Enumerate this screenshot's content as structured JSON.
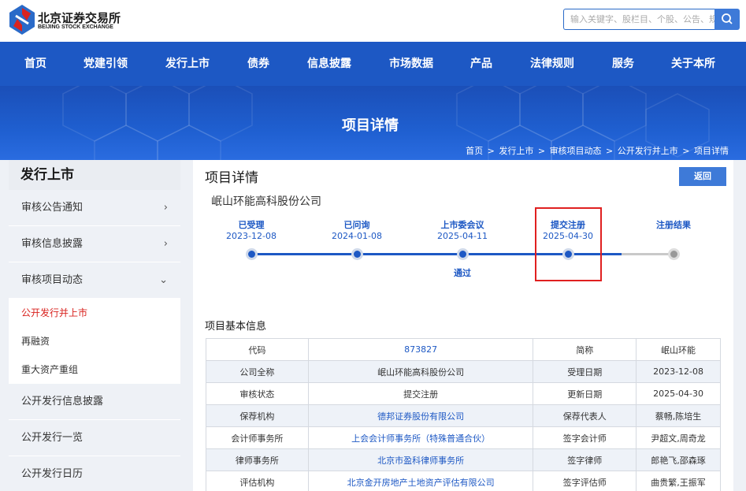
{
  "header": {
    "logo_cn": "北京证券交易所",
    "logo_en": "BEIJING STOCK EXCHANGE",
    "search_placeholder": "输入关键字、股栏目、个股、公告、规则"
  },
  "nav": [
    "首页",
    "党建引领",
    "发行上市",
    "债券",
    "信息披露",
    "市场数据",
    "产品",
    "法律规则",
    "服务",
    "关于本所"
  ],
  "banner": {
    "title": "项目详情",
    "breadcrumb": [
      "首页",
      "发行上市",
      "审核项目动态",
      "公开发行并上市",
      "项目详情"
    ]
  },
  "sidebar": {
    "title": "发行上市",
    "items": [
      {
        "label": "审核公告通知",
        "chevron": "›"
      },
      {
        "label": "审核信息披露",
        "chevron": "›"
      },
      {
        "label": "审核项目动态",
        "chevron": "⌄"
      }
    ],
    "subitems": [
      {
        "label": "公开发行并上市",
        "active": true
      },
      {
        "label": "再融资",
        "active": false
      },
      {
        "label": "重大资产重组",
        "active": false
      }
    ],
    "more": [
      "公开发行信息披露",
      "公开发行一览",
      "公开发行日历"
    ]
  },
  "main": {
    "title": "项目详情",
    "back_label": "返回",
    "company": "岷山环能高科股份公司",
    "timeline": [
      {
        "label": "已受理",
        "date": "2023-12-08",
        "note": "",
        "done": true
      },
      {
        "label": "已问询",
        "date": "2024-01-08",
        "note": "",
        "done": true
      },
      {
        "label": "上市委会议",
        "date": "2025-04-11",
        "note": "通过",
        "done": true
      },
      {
        "label": "提交注册",
        "date": "2025-04-30",
        "note": "",
        "done": true
      },
      {
        "label": "注册结果",
        "date": "",
        "note": "",
        "done": false
      }
    ],
    "basic_title": "项目基本信息",
    "rows": [
      {
        "k1": "代码",
        "v1": "873827",
        "k2": "简称",
        "v2": "岷山环能",
        "v1link": true
      },
      {
        "k1": "公司全称",
        "v1": "岷山环能高科股份公司",
        "k2": "受理日期",
        "v2": "2023-12-08",
        "v1link": false
      },
      {
        "k1": "审核状态",
        "v1": "提交注册",
        "k2": "更新日期",
        "v2": "2025-04-30",
        "v1link": false
      },
      {
        "k1": "保荐机构",
        "v1": "德邦证券股份有限公司",
        "k2": "保荐代表人",
        "v2": "蔡畅,陈培生",
        "v1link": true
      },
      {
        "k1": "会计师事务所",
        "v1": "上会会计师事务所（特殊普通合伙）",
        "k2": "签字会计师",
        "v2": "尹超文,周奇龙",
        "v1link": true
      },
      {
        "k1": "律师事务所",
        "v1": "北京市盈科律师事务所",
        "k2": "签字律师",
        "v2": "郎艳飞,邵森琢",
        "v1link": true
      },
      {
        "k1": "评估机构",
        "v1": "北京金开房地产土地资产评估有限公司",
        "k2": "签字评估师",
        "v2": "曲贵繁,王振军",
        "v1link": true
      }
    ]
  },
  "colors": {
    "brand_blue": "#1d58c4",
    "active_red": "#d9231f",
    "highlight_red": "#e02020"
  }
}
